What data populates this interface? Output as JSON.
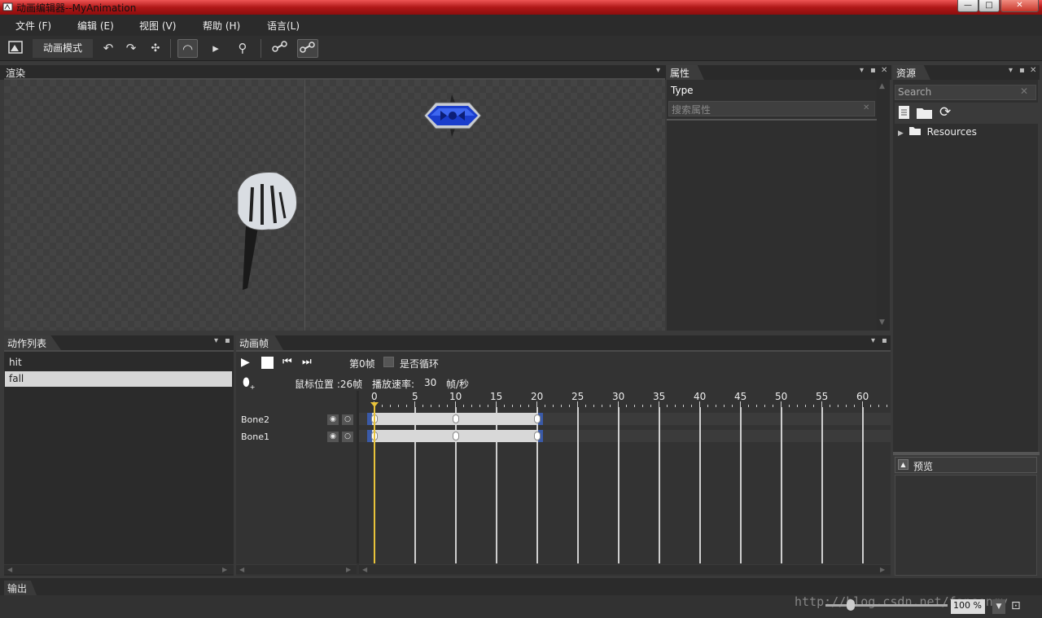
{
  "window": {
    "title": "动画编辑器--MyAnimation",
    "min": "—",
    "max": "□",
    "close": "✕"
  },
  "menu": [
    {
      "label": "文件 (F)"
    },
    {
      "label": "编辑 (E)"
    },
    {
      "label": "视图 (V)"
    },
    {
      "label": "帮助 (H)"
    },
    {
      "label": "语言(L)"
    }
  ],
  "toolbar": {
    "mode_label": "动画模式",
    "icons": [
      "app-icon",
      "undo-icon",
      "redo-icon",
      "move-icon",
      "rotate-icon",
      "select-icon",
      "zoom-icon",
      "bone-icon",
      "bone-bind-icon"
    ]
  },
  "panels": {
    "render": {
      "title": "渲染"
    },
    "properties": {
      "title": "属性",
      "type_label": "Type",
      "search_placeholder": "搜索属性"
    },
    "resources": {
      "title": "资源",
      "search_placeholder": "Search",
      "tree": [
        {
          "label": "Resources"
        }
      ]
    },
    "preview": {
      "title": "预览"
    },
    "actions": {
      "title": "动作列表",
      "items": [
        {
          "label": "hit",
          "selected": false
        },
        {
          "label": "fall",
          "selected": true
        }
      ]
    },
    "animframes": {
      "title": "动画帧",
      "frame_label": "第0帧",
      "loop_label": "是否循环",
      "mouse_pos_label": "鼠标位置 :26帧",
      "speed_label": "播放速率:",
      "speed_value": "30",
      "speed_unit": "帧/秒",
      "ruler": [
        "0",
        "5",
        "10",
        "15",
        "20",
        "25",
        "30",
        "35",
        "40",
        "45",
        "50",
        "55",
        "60"
      ],
      "tracks": [
        {
          "name": "Bone2",
          "keyframes": [
            0,
            10,
            20
          ]
        },
        {
          "name": "Bone1",
          "keyframes": [
            0,
            10,
            20
          ]
        }
      ],
      "current_frame": 0
    },
    "output": {
      "title": "输出"
    }
  },
  "status": {
    "zoom": "100 %",
    "watermark": "http://blog.csdn.net/fansongy"
  },
  "colors": {
    "titlebar": "#b01818",
    "accent_blue": "#3a5aa8",
    "playhead": "#e8c33a"
  }
}
